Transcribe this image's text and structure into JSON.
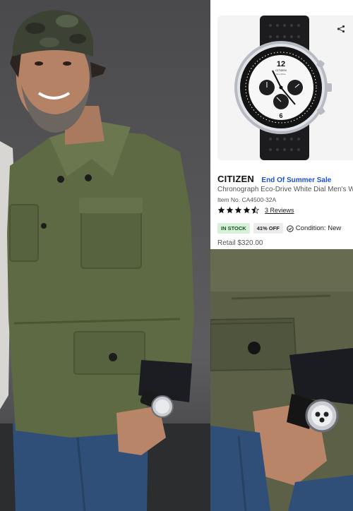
{
  "product": {
    "brand": "CITIZEN",
    "promo": "End Of Summer Sale",
    "name": "Chronograph Eco-Drive White Dial Men's Wa",
    "item_no": "Item No. CA4500-32A",
    "rating": 4.5,
    "reviews": "3 Reviews",
    "stock_badge": "IN STOCK",
    "discount_badge": "41% OFF",
    "condition": "Condition: New",
    "retail": "Retail $320.00",
    "watch_brand_text": "CITIZEN",
    "watch_sub_text": "Eco-Drive"
  },
  "icons": {
    "share": "share-icon",
    "star": "star-icon",
    "check": "check-circle-icon"
  },
  "colors": {
    "promo": "#1f4fd6",
    "stock_bg": "#d6f0d9",
    "stock_fg": "#16541f",
    "jacket": "#5e6a44",
    "jeans": "#2f4f78"
  }
}
